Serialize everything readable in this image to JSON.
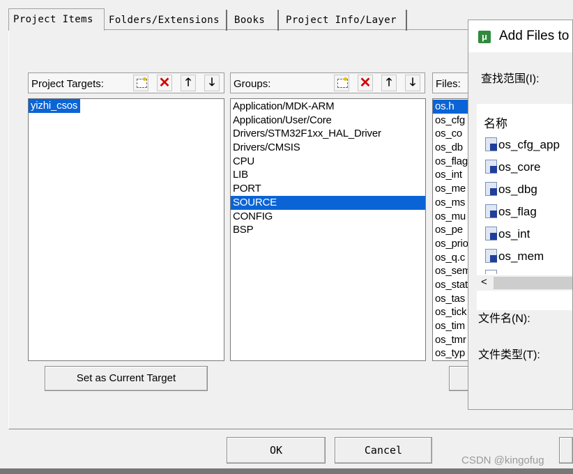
{
  "tabs": [
    "Project Items",
    "Folders/Extensions",
    "Books",
    "Project Info/Layer"
  ],
  "targets": {
    "label": "Project Targets:",
    "items": [
      "yizhi_csos"
    ],
    "set_current_button": "Set as Current Target"
  },
  "groups": {
    "label": "Groups:",
    "items": [
      "Application/MDK-ARM",
      "Application/User/Core",
      "Drivers/STM32F1xx_HAL_Driver",
      "Drivers/CMSIS",
      "CPU",
      "LIB",
      "PORT",
      "SOURCE",
      "CONFIG",
      "BSP"
    ],
    "selected": "SOURCE"
  },
  "files": {
    "label": "Files:",
    "items": [
      "os.h",
      "os_cfg",
      "os_co",
      "os_db",
      "os_flag",
      "os_int",
      "os_me",
      "os_ms",
      "os_mu",
      "os_pe",
      "os_prio",
      "os_q.c",
      "os_sem",
      "os_stat",
      "os_tas",
      "os_tick",
      "os_tim",
      "os_tmr",
      "os_typ"
    ],
    "selected": "os.h"
  },
  "icons": {
    "new": "new-folder-icon",
    "delete": "delete-icon",
    "up": "arrow-up-icon",
    "down": "arrow-down-icon"
  },
  "dialog": {
    "title": "Add Files to",
    "look_in_label": "查找范围(I):",
    "name_header": "名称",
    "files": [
      "os_cfg_app",
      "os_core",
      "os_dbg",
      "os_flag",
      "os_int",
      "os_mem"
    ],
    "scroll_left": "<",
    "filename_label": "文件名(N):",
    "filetype_label": "文件类型(T):"
  },
  "buttons": {
    "ok": "OK",
    "cancel": "Cancel"
  },
  "watermark": "CSDN @kingofug"
}
